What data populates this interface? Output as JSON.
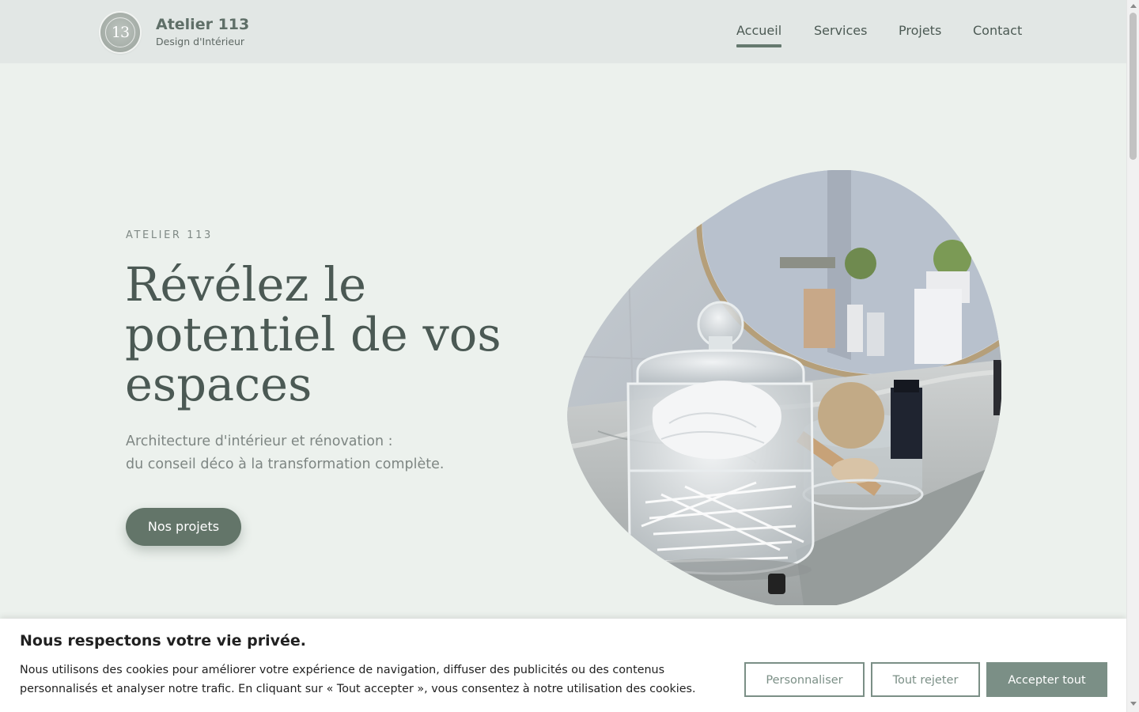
{
  "header": {
    "logo_monogram": "13",
    "brand_name": "Atelier 113",
    "brand_tagline": "Design d'Intérieur",
    "nav": [
      {
        "label": "Accueil",
        "active": true
      },
      {
        "label": "Services",
        "active": false
      },
      {
        "label": "Projets",
        "active": false
      },
      {
        "label": "Contact",
        "active": false
      }
    ]
  },
  "hero": {
    "eyebrow": "ATELIER 113",
    "headline": "Révélez le potentiel de vos espaces",
    "subtitle_line1": "Architecture d'intérieur et rénovation :",
    "subtitle_line2": "du conseil déco à la transformation complète.",
    "cta_label": "Nos projets",
    "image_icon": "bathroom-photo"
  },
  "cookie_banner": {
    "title": "Nous respectons votre vie privée.",
    "text": "Nous utilisons des cookies pour améliorer votre expérience de navigation, diffuser des publicités ou des contenus personnalisés et analyser notre trafic. En cliquant sur « Tout accepter », vous consentez à notre utilisation des cookies.",
    "buttons": {
      "customize": "Personnaliser",
      "reject": "Tout rejeter",
      "accept": "Accepter tout"
    }
  },
  "colors": {
    "page_bg": "#ecf1ed",
    "header_bg": "#e2e7e5",
    "accent": "#637569",
    "cookie_accent": "#7b8f86"
  }
}
